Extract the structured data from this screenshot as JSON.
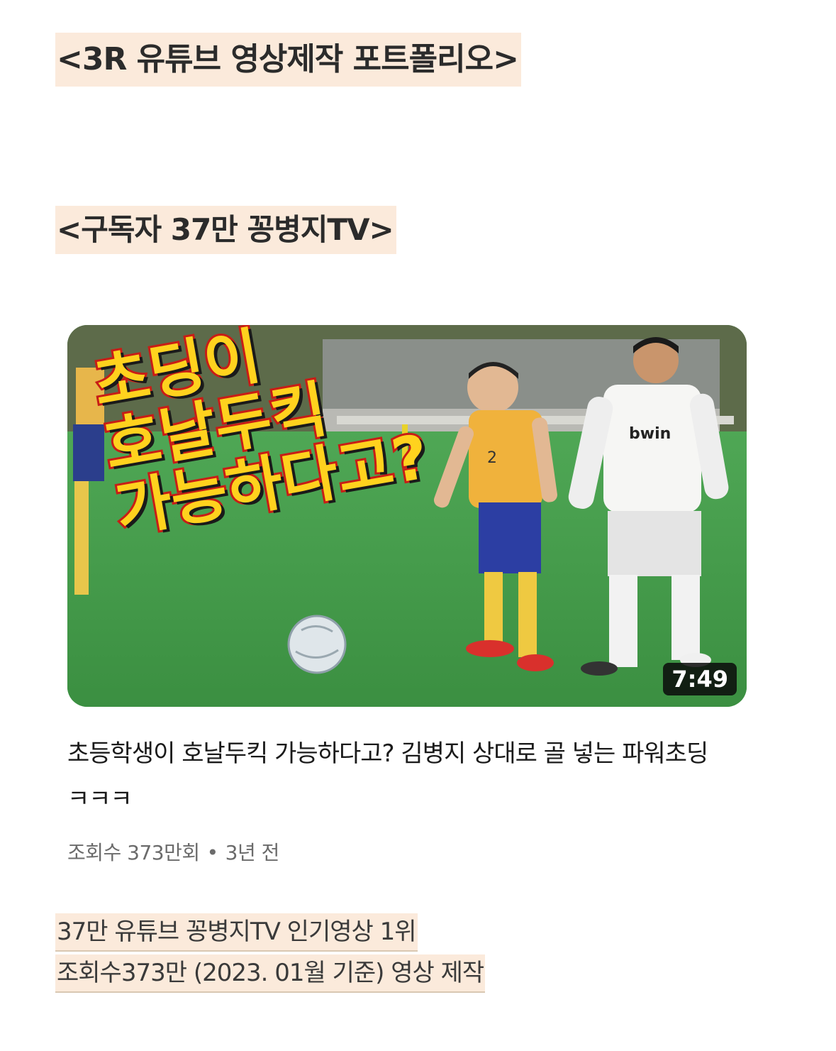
{
  "headings": {
    "main": "<3R 유튜브 영상제작 포트폴리오>",
    "channel": "<구독자 37만 꽁병지TV>"
  },
  "thumbnail": {
    "overlay_lines": [
      "초딩이",
      "호날두킥",
      "가능하다고?"
    ],
    "jersey_text": "bwin",
    "jersey_number": "2",
    "duration": "7:49"
  },
  "video": {
    "title": "초등학생이 호날두킥 가능하다고? 김병지 상대로 골 넣는 파워초딩ㅋㅋㅋ",
    "views": "조회수 373만회",
    "separator": "•",
    "age": "3년 전"
  },
  "footer": {
    "line1": "37만 유튜브 꽁병지TV 인기영상 1위",
    "line2": "조회수373만 (2023. 01월 기준) 영상 제작"
  },
  "colors": {
    "highlight": "#fbeadb",
    "grass": "#3f9a48",
    "caption_fill": "#ffd21e",
    "caption_stroke": "#c81d16"
  }
}
